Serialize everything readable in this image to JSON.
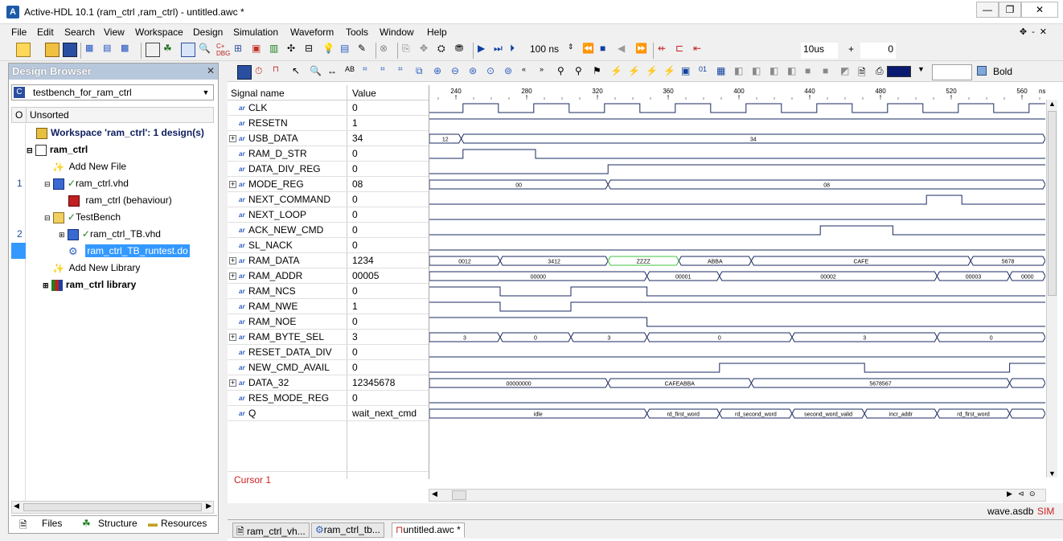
{
  "window": {
    "title": "Active-HDL 10.1 (ram_ctrl ,ram_ctrl) - untitled.awc *",
    "app_icon_letter": "A"
  },
  "menu": [
    "File",
    "Edit",
    "Search",
    "View",
    "Workspace",
    "Design",
    "Simulation",
    "Waveform",
    "Tools",
    "Window",
    "Help"
  ],
  "toolbar": {
    "sim_step": "100 ns",
    "sim_time": "10us",
    "plus": "+",
    "counter": "0"
  },
  "waveform_toolbar": {
    "color_label": "Bold"
  },
  "design_browser": {
    "title": "Design Browser",
    "selected_design": "testbench_for_ram_ctrl",
    "column_o": "O",
    "column_sort": "Unsorted",
    "tree": [
      {
        "num": "",
        "label": "Workspace 'ram_ctrl': 1 design(s)",
        "bold": true
      },
      {
        "num": "",
        "label": "ram_ctrl",
        "bold": true
      },
      {
        "num": "",
        "label": "Add New File",
        "bold": false
      },
      {
        "num": "1",
        "label": "ram_ctrl.vhd",
        "bold": false
      },
      {
        "num": "",
        "label": "ram_ctrl (behaviour)",
        "bold": false
      },
      {
        "num": "",
        "label": "TestBench",
        "bold": false
      },
      {
        "num": "2",
        "label": "ram_ctrl_TB.vhd",
        "bold": false
      },
      {
        "num": "",
        "label": "ram_ctrl_TB_runtest.do",
        "bold": false
      },
      {
        "num": "",
        "label": "Add New Library",
        "bold": false
      },
      {
        "num": "",
        "label": "ram_ctrl library",
        "bold": true
      }
    ],
    "tabs": [
      "Files",
      "Structure",
      "Resources"
    ]
  },
  "waveform": {
    "col_signal": "Signal name",
    "col_value": "Value",
    "timescale_unit": "ns",
    "time_ticks": [
      "240",
      "280",
      "320",
      "360",
      "400",
      "440",
      "480",
      "520",
      "560"
    ],
    "cursor_label": "Cursor 1",
    "status_file": "wave.asdb",
    "status_mode": "SIM",
    "signals": [
      {
        "name": "CLK",
        "value": "0",
        "bus": false
      },
      {
        "name": "RESETN",
        "value": "1",
        "bus": false
      },
      {
        "name": "USB_DATA",
        "value": "34",
        "bus": true
      },
      {
        "name": "RAM_D_STR",
        "value": "0",
        "bus": false
      },
      {
        "name": "DATA_DIV_REG",
        "value": "0",
        "bus": false
      },
      {
        "name": "MODE_REG",
        "value": "08",
        "bus": true
      },
      {
        "name": "NEXT_COMMAND",
        "value": "0",
        "bus": false
      },
      {
        "name": "NEXT_LOOP",
        "value": "0",
        "bus": false
      },
      {
        "name": "ACK_NEW_CMD",
        "value": "0",
        "bus": false
      },
      {
        "name": "SL_NACK",
        "value": "0",
        "bus": false
      },
      {
        "name": "RAM_DATA",
        "value": "1234",
        "bus": true
      },
      {
        "name": "RAM_ADDR",
        "value": "00005",
        "bus": true
      },
      {
        "name": "RAM_NCS",
        "value": "0",
        "bus": false
      },
      {
        "name": "RAM_NWE",
        "value": "1",
        "bus": false
      },
      {
        "name": "RAM_NOE",
        "value": "0",
        "bus": false
      },
      {
        "name": "RAM_BYTE_SEL",
        "value": "3",
        "bus": true
      },
      {
        "name": "RESET_DATA_DIV",
        "value": "0",
        "bus": false
      },
      {
        "name": "NEW_CMD_AVAIL",
        "value": "0",
        "bus": false
      },
      {
        "name": "DATA_32",
        "value": "12345678",
        "bus": true
      },
      {
        "name": "RES_MODE_REG",
        "value": "0",
        "bus": false
      },
      {
        "name": "Q",
        "value": "wait_next_cmd",
        "bus": false
      }
    ],
    "bus_labels": {
      "USB_DATA": [
        "12",
        "34"
      ],
      "MODE_REG": [
        "00",
        "08"
      ],
      "RAM_DATA": [
        "0012",
        "3412",
        "ZZZZ",
        "ABBA",
        "CAFE",
        "5678"
      ],
      "RAM_ADDR": [
        "00000",
        "00001",
        "00002",
        "00003",
        "0000"
      ],
      "RAM_BYTE_SEL": [
        "3",
        "0",
        "3",
        "0",
        "3",
        "0"
      ],
      "DATA_32": [
        "00000000",
        "CAFEABBA",
        "5678567"
      ],
      "Q": [
        "idle",
        "rd_first_word",
        "rd_second_word",
        "second_word_valid",
        "incr_addr",
        "rd_first_word"
      ]
    }
  },
  "doc_tabs": [
    "ram_ctrl_vh...",
    "ram_ctrl_tb...",
    "untitled.awc *"
  ]
}
